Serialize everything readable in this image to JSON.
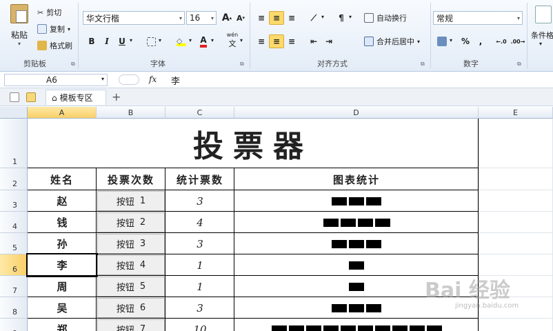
{
  "ribbon": {
    "clipboard": {
      "group": "剪贴板",
      "paste": "粘贴",
      "cut": "剪切",
      "copy": "复制",
      "format_painter": "格式刷"
    },
    "font": {
      "group": "字体",
      "font_name": "华文行楷",
      "font_size": "16",
      "grow": "A",
      "shrink": "A",
      "bold": "B",
      "italic": "I",
      "underline": "U",
      "font_color_glyph": "A",
      "wen": "wén"
    },
    "alignment": {
      "group": "对齐方式",
      "wrap_text": "自动换行",
      "merge_center": "合并后居中"
    },
    "number": {
      "group": "数字",
      "format": "常规",
      "percent": "%",
      "comma": ","
    },
    "styles": {
      "conditional": "条件格"
    }
  },
  "formula_bar": {
    "name_box": "A6",
    "fx": "fx",
    "content": "李"
  },
  "tabs": {
    "template_zone": "模板专区",
    "new_tab": "+"
  },
  "columns": [
    "A",
    "B",
    "C",
    "D",
    "E"
  ],
  "rows": [
    "1",
    "2",
    "3",
    "4",
    "5",
    "6",
    "7",
    "8",
    "9"
  ],
  "sheet": {
    "title": "投票器",
    "headers": [
      "姓名",
      "投票次数",
      "统计票数",
      "图表统计"
    ],
    "entries": [
      {
        "name": "赵",
        "button": "按钮",
        "num": "1",
        "count": "3",
        "bars": 3
      },
      {
        "name": "钱",
        "button": "按钮",
        "num": "2",
        "count": "4",
        "bars": 4
      },
      {
        "name": "孙",
        "button": "按钮",
        "num": "3",
        "count": "3",
        "bars": 3
      },
      {
        "name": "李",
        "button": "按钮",
        "num": "4",
        "count": "1",
        "bars": 1
      },
      {
        "name": "周",
        "button": "按钮",
        "num": "5",
        "count": "1",
        "bars": 1
      },
      {
        "name": "吴",
        "button": "按钮",
        "num": "6",
        "count": "3",
        "bars": 3
      },
      {
        "name": "郑",
        "button": "按钮",
        "num": "7",
        "count": "10",
        "bars": 10
      }
    ]
  },
  "watermark": {
    "brand": "Bai 经验",
    "url": "jingyan.baidu.com"
  },
  "colors": {
    "selected_header": "#f9cf68",
    "ribbon_bg": "#e3ecf7",
    "button_bg": "#efefef"
  }
}
